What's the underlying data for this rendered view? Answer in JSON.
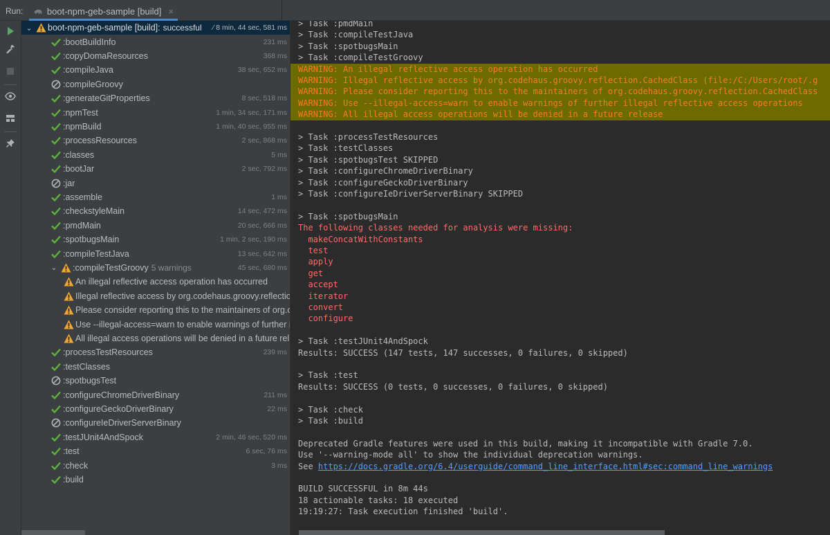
{
  "header": {
    "run_label": "Run:",
    "tab_title": "boot-npm-geb-sample [build]",
    "tab_close": "×"
  },
  "tree": [
    {
      "label": "boot-npm-geb-sample [build]:",
      "meta": "successful",
      "dur": "8 min, 44 sec, 581 ms",
      "icon": "warning",
      "indent": 0,
      "chevron": "⌄",
      "selected": true,
      "bright": true
    },
    {
      "label": ":bootBuildInfo",
      "dur": "231 ms",
      "icon": "check",
      "indent": 1
    },
    {
      "label": ":copyDomaResources",
      "dur": "368 ms",
      "icon": "check",
      "indent": 1
    },
    {
      "label": ":compileJava",
      "dur": "38 sec, 652 ms",
      "icon": "check",
      "indent": 1
    },
    {
      "label": ":compileGroovy",
      "dur": "",
      "icon": "skipped",
      "indent": 1
    },
    {
      "label": ":generateGitProperties",
      "dur": "8 sec, 518 ms",
      "icon": "check",
      "indent": 1
    },
    {
      "label": ":npmTest",
      "dur": "1 min, 34 sec, 171 ms",
      "icon": "check",
      "indent": 1
    },
    {
      "label": ":npmBuild",
      "dur": "1 min, 40 sec, 955 ms",
      "icon": "check",
      "indent": 1
    },
    {
      "label": ":processResources",
      "dur": "2 sec, 868 ms",
      "icon": "check",
      "indent": 1
    },
    {
      "label": ":classes",
      "dur": "5 ms",
      "icon": "check",
      "indent": 1
    },
    {
      "label": ":bootJar",
      "dur": "2 sec, 792 ms",
      "icon": "check",
      "indent": 1
    },
    {
      "label": ":jar",
      "dur": "",
      "icon": "skipped",
      "indent": 1
    },
    {
      "label": ":assemble",
      "dur": "1 ms",
      "icon": "check",
      "indent": 1
    },
    {
      "label": ":checkstyleMain",
      "dur": "14 sec, 472 ms",
      "icon": "check",
      "indent": 1
    },
    {
      "label": ":pmdMain",
      "dur": "20 sec, 666 ms",
      "icon": "check",
      "indent": 1
    },
    {
      "label": ":spotbugsMain",
      "dur": "1 min, 2 sec, 190 ms",
      "icon": "check",
      "indent": 1
    },
    {
      "label": ":compileTestJava",
      "dur": "13 sec, 642 ms",
      "icon": "check",
      "indent": 1
    },
    {
      "label": ":compileTestGroovy",
      "meta": "5 warnings",
      "dur": "45 sec, 680 ms",
      "icon": "warning",
      "indent": 1,
      "chevron": "⌄"
    },
    {
      "label": "An illegal reflective access operation has occurred",
      "dur": "",
      "icon": "warning",
      "indent": 2
    },
    {
      "label": "Illegal reflective access by org.codehaus.groovy.reflectio",
      "dur": "",
      "icon": "warning",
      "indent": 2
    },
    {
      "label": "Please consider reporting this to the maintainers of org.c",
      "dur": "",
      "icon": "warning",
      "indent": 2
    },
    {
      "label": "Use --illegal-access=warn to enable warnings of further i",
      "dur": "",
      "icon": "warning",
      "indent": 2
    },
    {
      "label": "All illegal access operations will be denied in a future rel",
      "dur": "",
      "icon": "warning",
      "indent": 2
    },
    {
      "label": ":processTestResources",
      "dur": "239 ms",
      "icon": "check",
      "indent": 1
    },
    {
      "label": ":testClasses",
      "dur": "",
      "icon": "check",
      "indent": 1
    },
    {
      "label": ":spotbugsTest",
      "dur": "",
      "icon": "skipped",
      "indent": 1
    },
    {
      "label": ":configureChromeDriverBinary",
      "dur": "211 ms",
      "icon": "check",
      "indent": 1
    },
    {
      "label": ":configureGeckoDriverBinary",
      "dur": "22 ms",
      "icon": "check",
      "indent": 1
    },
    {
      "label": ":configureIeDriverServerBinary",
      "dur": "",
      "icon": "skipped",
      "indent": 1
    },
    {
      "label": ":testJUnit4AndSpock",
      "dur": "2 min, 46 sec, 520 ms",
      "icon": "check",
      "indent": 1
    },
    {
      "label": ":test",
      "dur": "6 sec, 76 ms",
      "icon": "check",
      "indent": 1
    },
    {
      "label": ":check",
      "dur": "3 ms",
      "icon": "check",
      "indent": 1
    },
    {
      "label": ":build",
      "dur": "",
      "icon": "check",
      "indent": 1
    }
  ],
  "console": [
    {
      "text": "> Task :pmdMain",
      "style": "normal"
    },
    {
      "text": "> Task :compileTestJava",
      "style": "normal"
    },
    {
      "text": "> Task :spotbugsMain",
      "style": "normal"
    },
    {
      "text": "> Task :compileTestGroovy",
      "style": "normal"
    },
    {
      "text": "WARNING: An illegal reflective access operation has occurred",
      "style": "warn"
    },
    {
      "text": "WARNING: Illegal reflective access by org.codehaus.groovy.reflection.CachedClass (file:/C:/Users/root/.g",
      "style": "warn"
    },
    {
      "text": "WARNING: Please consider reporting this to the maintainers of org.codehaus.groovy.reflection.CachedClass",
      "style": "warn"
    },
    {
      "text": "WARNING: Use --illegal-access=warn to enable warnings of further illegal reflective access operations",
      "style": "warn"
    },
    {
      "text": "WARNING: All illegal access operations will be denied in a future release",
      "style": "warn"
    },
    {
      "text": "",
      "style": "normal"
    },
    {
      "text": "> Task :processTestResources",
      "style": "normal"
    },
    {
      "text": "> Task :testClasses",
      "style": "normal"
    },
    {
      "text": "> Task :spotbugsTest SKIPPED",
      "style": "normal"
    },
    {
      "text": "> Task :configureChromeDriverBinary",
      "style": "normal"
    },
    {
      "text": "> Task :configureGeckoDriverBinary",
      "style": "normal"
    },
    {
      "text": "> Task :configureIeDriverServerBinary SKIPPED",
      "style": "normal"
    },
    {
      "text": "",
      "style": "normal"
    },
    {
      "text": "> Task :spotbugsMain",
      "style": "normal"
    },
    {
      "text": "The following classes needed for analysis were missing:",
      "style": "red"
    },
    {
      "text": "  makeConcatWithConstants",
      "style": "red"
    },
    {
      "text": "  test",
      "style": "red"
    },
    {
      "text": "  apply",
      "style": "red"
    },
    {
      "text": "  get",
      "style": "red"
    },
    {
      "text": "  accept",
      "style": "red"
    },
    {
      "text": "  iterator",
      "style": "red"
    },
    {
      "text": "  convert",
      "style": "red"
    },
    {
      "text": "  configure",
      "style": "red"
    },
    {
      "text": "",
      "style": "normal"
    },
    {
      "text": "> Task :testJUnit4AndSpock",
      "style": "normal"
    },
    {
      "text": "Results: SUCCESS (147 tests, 147 successes, 0 failures, 0 skipped)",
      "style": "normal"
    },
    {
      "text": "",
      "style": "normal"
    },
    {
      "text": "> Task :test",
      "style": "normal"
    },
    {
      "text": "Results: SUCCESS (0 tests, 0 successes, 0 failures, 0 skipped)",
      "style": "normal"
    },
    {
      "text": "",
      "style": "normal"
    },
    {
      "text": "> Task :check",
      "style": "normal"
    },
    {
      "text": "> Task :build",
      "style": "normal"
    },
    {
      "text": "",
      "style": "normal"
    },
    {
      "text": "Deprecated Gradle features were used in this build, making it incompatible with Gradle 7.0.",
      "style": "normal"
    },
    {
      "text": "Use '--warning-mode all' to show the individual deprecation warnings.",
      "style": "normal"
    },
    {
      "text": "See ",
      "link": "https://docs.gradle.org/6.4/userguide/command_line_interface.html#sec:command_line_warnings",
      "style": "normal"
    },
    {
      "text": "",
      "style": "normal"
    },
    {
      "text": "BUILD SUCCESSFUL in 8m 44s",
      "style": "normal"
    },
    {
      "text": "18 actionable tasks: 18 executed",
      "style": "normal"
    },
    {
      "text": "19:19:27: Task execution finished 'build'.",
      "style": "normal"
    }
  ],
  "colors": {
    "success": "#5fb13f",
    "warning": "#f0a732",
    "skipped": "#afb1b3",
    "run": "#59a869"
  }
}
